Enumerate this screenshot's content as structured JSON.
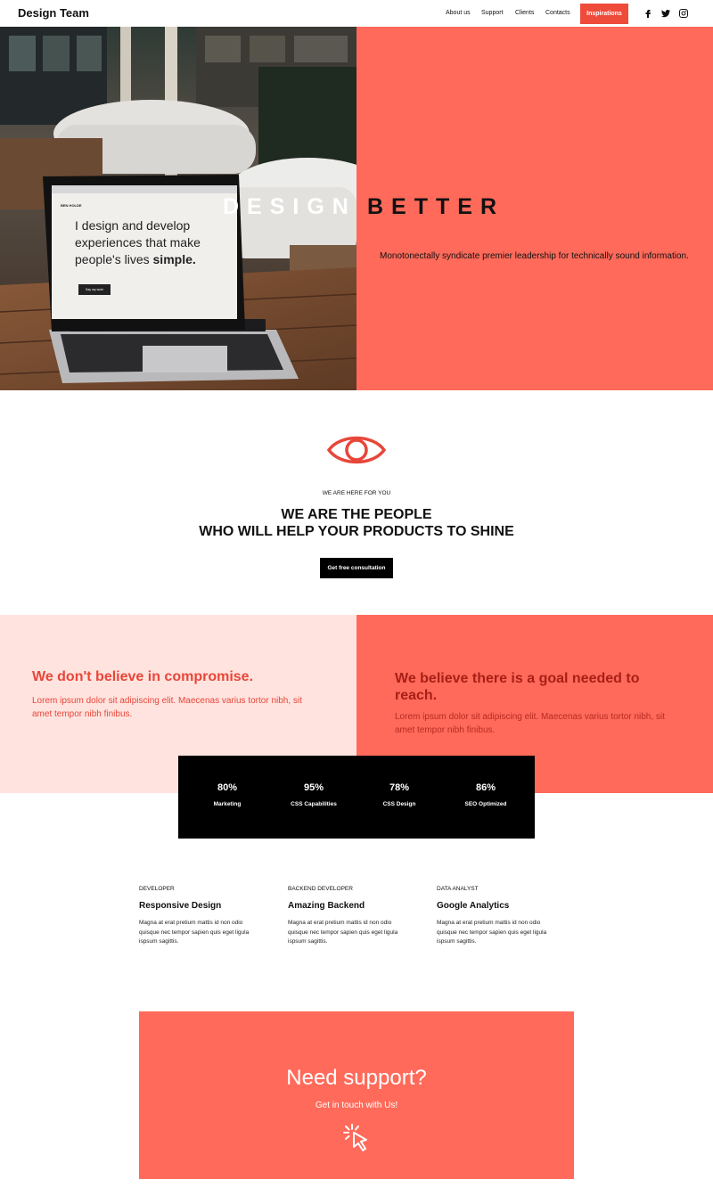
{
  "header": {
    "brand": "Design Team",
    "nav": [
      "About us",
      "Support",
      "Clients",
      "Contacts"
    ],
    "cta": "Inspirations",
    "social_icons": [
      "facebook-icon",
      "twitter-icon",
      "instagram-icon"
    ]
  },
  "hero": {
    "title_word1": "DESIGN",
    "title_word2": "BETTER",
    "subtitle": "Monotonectally syndicate premier leadership for technically sound information.",
    "laptop_screen": {
      "brand": "BEN HOLDE",
      "line1": "I design and develop",
      "line2": "experiences that make",
      "line3": "people's lives",
      "line3_bold": "simple.",
      "button": "Say my work"
    }
  },
  "intro": {
    "icon": "eye-icon",
    "eyebrow": "WE ARE HERE FOR YOU",
    "headline_line1": "WE ARE THE PEOPLE",
    "headline_line2": "WHO WILL HELP YOUR PRODUCTS TO SHINE",
    "button": "Get free consultation"
  },
  "beliefs": {
    "left_title": "We don't believe in compromise.",
    "left_text": "Lorem ipsum dolor sit adipiscing elit. Maecenas varius tortor nibh, sit amet tempor nibh finibus.",
    "right_title": "We believe there is a goal needed to reach.",
    "right_text": "Lorem ipsum dolor sit adipiscing elit. Maecenas varius tortor nibh, sit amet tempor nibh finibus."
  },
  "stats": [
    {
      "value": "80%",
      "label": "Marketing"
    },
    {
      "value": "95%",
      "label": "CSS Capabilities"
    },
    {
      "value": "78%",
      "label": "CSS Design"
    },
    {
      "value": "86%",
      "label": "SEO Optimized"
    }
  ],
  "roles": [
    {
      "kicker": "DEVELOPER",
      "title": "Responsive Design",
      "desc": "Magna at erat pretium mattis id non odio quisque nec tempor sapien quis eget ligula ispsum sagittis."
    },
    {
      "kicker": "BACKEND DEVELOPER",
      "title": "Amazing Backend",
      "desc": "Magna at erat pretium mattis id non odio quisque nec tempor sapien quis eget ligula ispsum sagittis."
    },
    {
      "kicker": "DATA ANALYST",
      "title": "Google Analytics",
      "desc": "Magna at erat pretium mattis id non odio quisque nec tempor sapien quis eget ligula ispsum sagittis."
    }
  ],
  "support": {
    "title": "Need support?",
    "subtitle": "Get in touch with Us!",
    "icon": "pointer-click-icon"
  },
  "colors": {
    "coral": "#ff6a5a",
    "red": "#ef4b3a",
    "blush": "#ffe3de",
    "black": "#000000"
  }
}
